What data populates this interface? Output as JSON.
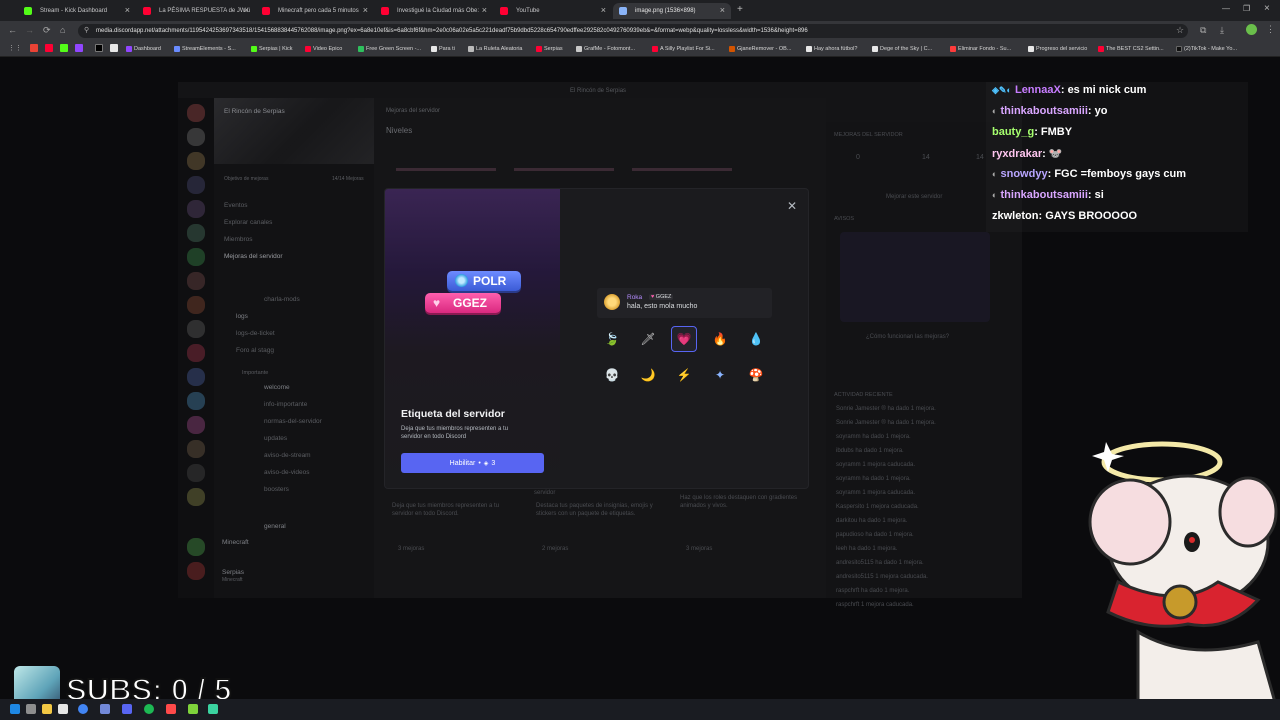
{
  "browser": {
    "tabs": [
      {
        "label": "Stream - Kick Dashboard",
        "color": "#53fc18"
      },
      {
        "label": "La PÉSIMA RESPUESTA de JW.ü",
        "color": "#ff0033"
      },
      {
        "label": "Minecraft pero cada 5 minutos",
        "color": "#ff0033"
      },
      {
        "label": "Investigué la Ciudad más Obe:",
        "color": "#ff0033"
      },
      {
        "label": "YouTube",
        "color": "#ff0033"
      },
      {
        "label": "image.png (1536×898)",
        "color": "#8ab4f8"
      }
    ],
    "url": "media.discordapp.net/attachments/1195424253697343518/1541568838445762088/image.png?ex=6a8e10ef&is=6a8cbf6f&hm=2e0c06a02e5a5c221deadf75b9dbd5228c654790edffee292582c0492760939eb&=&format=webp&quality=lossless&width=1536&height=896",
    "bookmarks": [
      "Dashboard",
      "StreamElements - S...",
      "Serpias | Kick",
      "Video Epico",
      "Free Green Screen -...",
      "Para ti",
      "La Ruleta Aleatoria",
      "Serpias",
      "GrafMe - Fotomont...",
      "A Silly Playlist For Si...",
      "GjaneRemover - OB...",
      "Hay ahora fútbol?",
      "Dege of the Sky | C...",
      "Eliminar Fondo - Su...",
      "Progreso del servicio",
      "The BEST CS2 Settin...",
      "(2)TikTok - Make Yo..."
    ]
  },
  "discord": {
    "window_title": "El Rincón de Serpias",
    "server_name": "El Rincón de Serpias",
    "boost_progress": "Objetivo de mejoras",
    "boost_count": "14/14 Mejoras",
    "channels": [
      "Eventos",
      "Explorar canales",
      "Miembros",
      "Mejoras del servidor",
      "charla-mods",
      "logs",
      "logs-de-ticket",
      "Foro al stagg",
      "Importante",
      "welcome",
      "info-importante",
      "normas-del-servidor",
      "updates",
      "aviso-de-stream",
      "aviso-de-videos",
      "boosters",
      "general"
    ],
    "page_title": "Mejoras del servidor",
    "section_title": "Niveles",
    "side_panel_title": "MEJORAS DEL SERVIDOR",
    "boost_stats": [
      "0",
      "14",
      "14"
    ],
    "boost_server_btn": "Mejorar este servidor",
    "avisos": "AVISOS",
    "how_boosts_work": "¿Cómo funcionan las mejoras?",
    "recent_activity": "ACTIVIDAD RECIENTE",
    "activity": [
      "Sonrie Jamester ® ha dado 1 mejora.",
      "Sonrie Jamester ® ha dado 1 mejora.",
      "soyramm ha dado 1 mejora.",
      "ibdubs ha dado 1 mejora.",
      "soyramm 1 mejora caducada.",
      "soyramm ha dado 1 mejora.",
      "soyramm 1 mejora caducada.",
      "Kaspersito 1 mejora caducada.",
      "darkitou ha dado 1 mejora.",
      "papudioso ha dado 1 mejora.",
      "leeh ha dado 1 mejora.",
      "andresito5115 ha dado 1 mejora.",
      "andresito5115 1 mejora caducada.",
      "raspchrft ha dado 1 mejora.",
      "raspchrft 1 mejora caducada."
    ],
    "perk_cards": [
      {
        "title": "servidor",
        "desc": "Deja que tus miembros representen a tu servidor en todo Discord.",
        "count": "3 mejoras"
      },
      {
        "title": "",
        "desc": "Destaca tus paquetes de insignias, emojis y stickers con un paquete de etiquetas.",
        "count": "2 mejoras"
      },
      {
        "title": "",
        "desc": "Haz que los roles destaquen con gradientes animados y vivos.",
        "count": "3 mejoras"
      }
    ],
    "voice_channel": "Minecraft",
    "user_name": "Serpias",
    "user_status": "Minecraft"
  },
  "modal": {
    "tag_primary": "POLR",
    "tag_secondary": "GGEZ",
    "title": "Etiqueta del servidor",
    "description": "Deja que tus miembros representen a tu servidor en todo Discord",
    "enable_label": "Habilitar",
    "enable_cost": "3",
    "preview": {
      "name": "Roka",
      "tag": "GGEZ",
      "message": "hala, esto mola mucho"
    },
    "badges": [
      {
        "icon": "leaf-icon",
        "glyph": "🍃",
        "selected": false
      },
      {
        "icon": "sword-icon",
        "glyph": "🗡",
        "selected": false
      },
      {
        "icon": "heart-icon",
        "glyph": "💗",
        "selected": true
      },
      {
        "icon": "fire-icon",
        "glyph": "🔥",
        "selected": false
      },
      {
        "icon": "water-drop-icon",
        "glyph": "💧",
        "selected": false
      },
      {
        "icon": "skull-icon",
        "glyph": "💀",
        "selected": false
      },
      {
        "icon": "moon-icon",
        "glyph": "🌙",
        "selected": false
      },
      {
        "icon": "lightning-icon",
        "glyph": "⚡",
        "selected": false
      },
      {
        "icon": "sparkle-icon",
        "glyph": "✦",
        "selected": false
      },
      {
        "icon": "mushroom-icon",
        "glyph": "🍄",
        "selected": false
      }
    ]
  },
  "chat": [
    {
      "user": "LennaaX",
      "color": "#c77dff",
      "msg": "es mi nick cum"
    },
    {
      "user": "thinkaboutsamiii",
      "color": "#d9a6ff",
      "msg": "yo"
    },
    {
      "user": "bauty_g",
      "color": "#a6ff6e",
      "msg": "FMBY"
    },
    {
      "user": "ryxdrakar",
      "color": "#ffc6f0",
      "msg": "🐭"
    },
    {
      "user": "snowdyy",
      "color": "#b9a6ff",
      "msg": "FGC =femboys gays cum"
    },
    {
      "user": "thinkaboutsamiii",
      "color": "#d9a6ff",
      "msg": "si"
    },
    {
      "user": "zkwleton",
      "color": "#ffffff",
      "msg": "GAYS BROOOOO"
    }
  ],
  "overlay": {
    "subs_label": "SUBS: 0 / 5"
  }
}
